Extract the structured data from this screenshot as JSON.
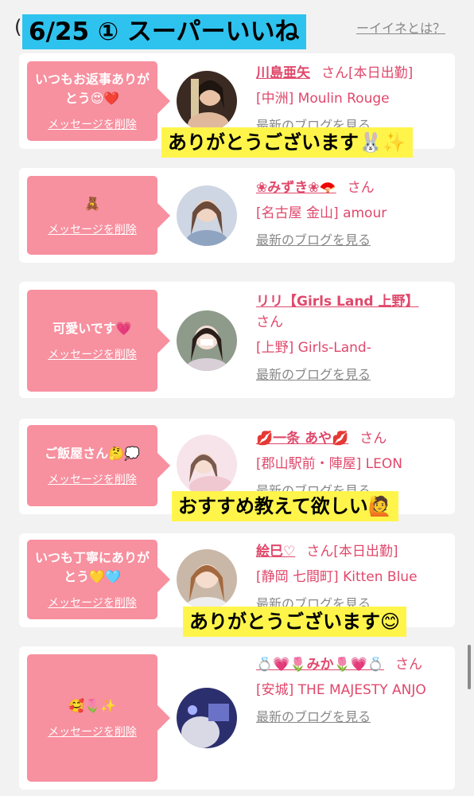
{
  "header": {
    "paren": "(",
    "title": "6/25 ① スーパーいいね",
    "what_is": "ーイイネとは？"
  },
  "delete_label": "メッセージを削除",
  "blog_label": "最新のブログを見る",
  "san_label": "さん",
  "cards": [
    {
      "message": "いつもお返事ありがとう😍❤️",
      "name": "川島亜矢",
      "attendance": "[本日出勤]",
      "location": "[中洲] Moulin Rouge",
      "overlay": "ありがとうございます🐰✨"
    },
    {
      "message": "🧸",
      "name": "❀みずき❀🪭",
      "location": "[名古屋 金山] amour"
    },
    {
      "message": "可愛いです💗",
      "name": "リリ【Girls Land 上野】",
      "location": "[上野] Girls-Land-"
    },
    {
      "message": "ご飯屋さん🤔💭",
      "name": "💋一条 あや💋",
      "location": "[郡山駅前・陣屋] LEON",
      "overlay": "おすすめ教えて欲しい🙋"
    },
    {
      "message": "いつも丁寧にありがとう💛🩵",
      "name": "絵巳♡",
      "attendance": "[本日出勤]",
      "location": "[静岡 七間町] Kitten Blue",
      "overlay": "ありがとうございます😊"
    },
    {
      "message": "🥰🌷✨",
      "name": "💍💗🌷みか🌷💗💍",
      "location": "[安城] THE MAJESTY ANJO"
    }
  ]
}
